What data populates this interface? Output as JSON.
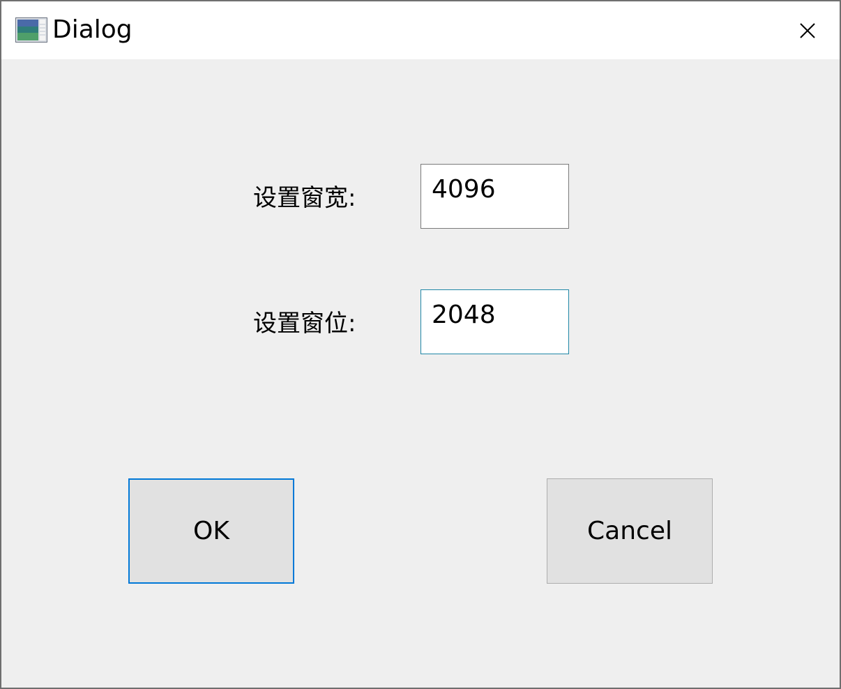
{
  "window": {
    "title": "Dialog",
    "icon": "app-window-icon",
    "close_icon": "close-icon"
  },
  "form": {
    "width_label": "设置窗宽:",
    "width_value": "4096",
    "level_label": "设置窗位:",
    "level_value": "2048"
  },
  "buttons": {
    "ok_label": "OK",
    "cancel_label": "Cancel"
  },
  "colors": {
    "dialog_bg": "#efefef",
    "titlebar_bg": "#ffffff",
    "default_button_border": "#0078d7",
    "focused_input_border": "#1f86a6"
  }
}
